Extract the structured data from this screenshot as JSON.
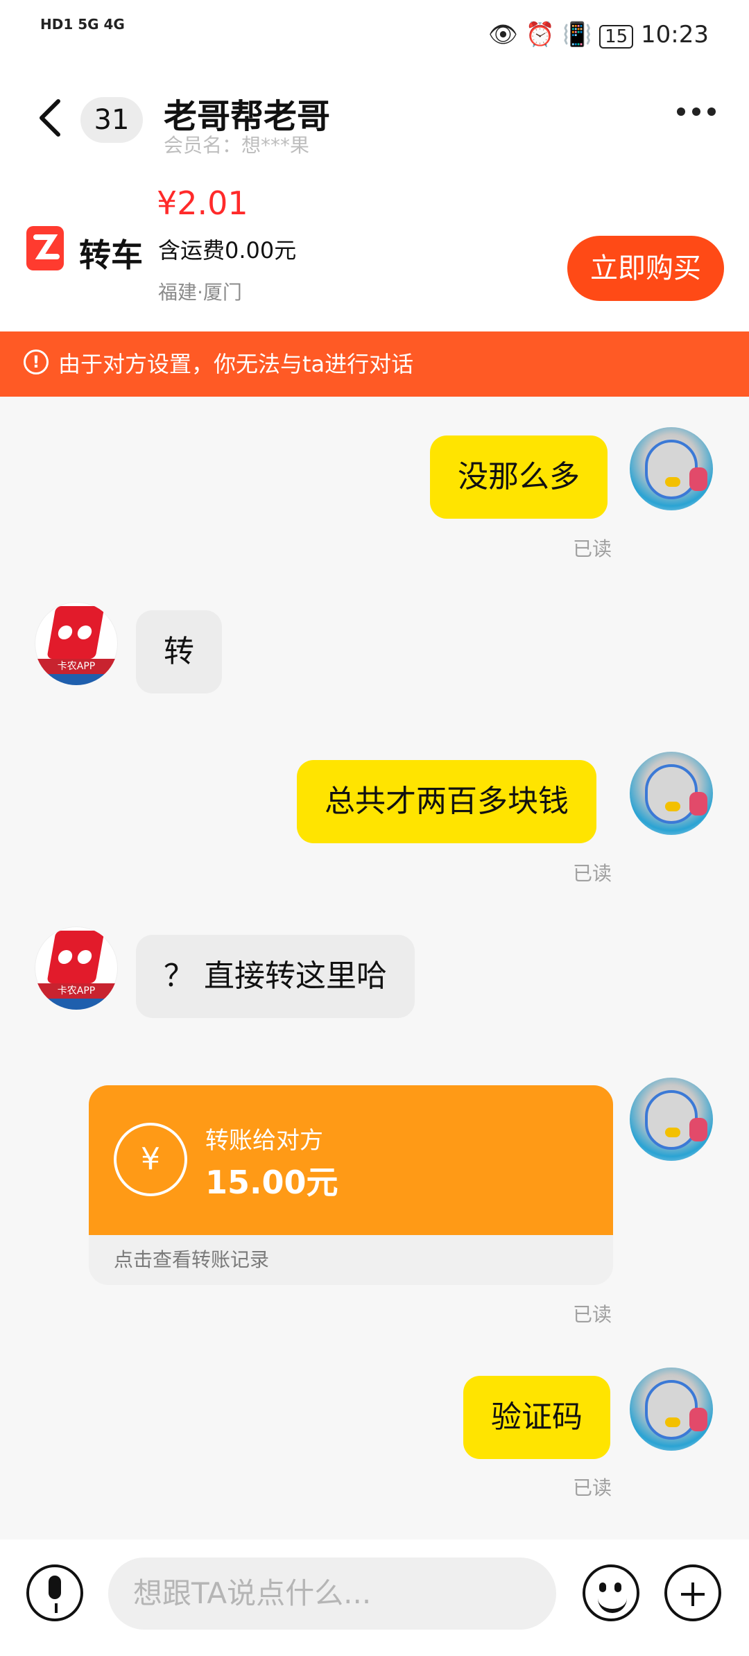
{
  "status_bar": {
    "left_text": "HD1 5G 4G",
    "time": "10:23",
    "battery": "15"
  },
  "header": {
    "unread_count": "31",
    "title": "老哥帮老哥",
    "member_name": "会员名：想***果"
  },
  "product": {
    "logo_text": "转车",
    "price": "¥2.01",
    "shipping": "含运费0.00元",
    "location": "福建·厦门",
    "buy_label": "立即购买"
  },
  "notice": {
    "text": "由于对方设置，你无法与ta进行对话"
  },
  "messages": [
    {
      "side": "mine",
      "text": "没那么多",
      "read": "已读"
    },
    {
      "side": "theirs",
      "text": "转"
    },
    {
      "side": "mine",
      "text": "总共才两百多块钱",
      "read": "已读"
    },
    {
      "side": "theirs",
      "text": "？ 直接转这里哈"
    },
    {
      "side": "mine",
      "type": "transfer",
      "title": "转账给对方",
      "amount": "15.00元",
      "link": "点击查看转账记录",
      "read": "已读"
    },
    {
      "side": "mine",
      "text": "验证码",
      "read": "已读"
    }
  ],
  "other_avatar_label": "卡农APP",
  "input": {
    "placeholder": "想跟TA说点什么..."
  }
}
